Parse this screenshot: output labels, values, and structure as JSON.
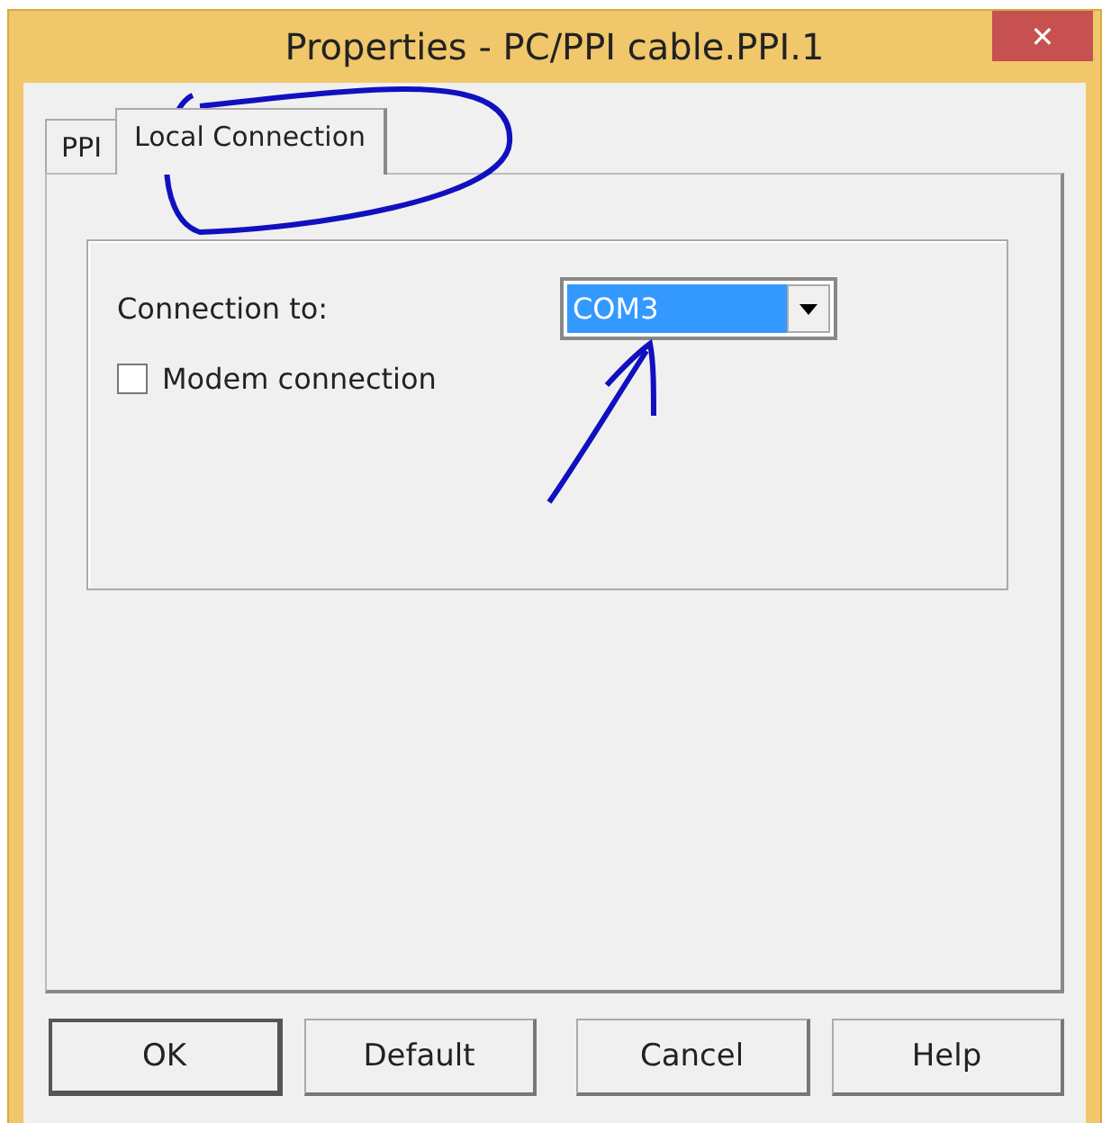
{
  "window": {
    "title": "Properties - PC/PPI cable.PPI.1",
    "close": "✕"
  },
  "tabs": [
    {
      "label": "PPI",
      "selected": false
    },
    {
      "label": "Local Connection",
      "selected": true
    }
  ],
  "connection": {
    "label": "Connection to:",
    "value": "COM3"
  },
  "modem": {
    "label": "Modem connection",
    "checked": false
  },
  "buttons": [
    {
      "label": "OK",
      "default": true
    },
    {
      "label": "Default",
      "default": false
    },
    {
      "label": "Cancel",
      "default": false
    },
    {
      "label": "Help",
      "default": false
    }
  ]
}
